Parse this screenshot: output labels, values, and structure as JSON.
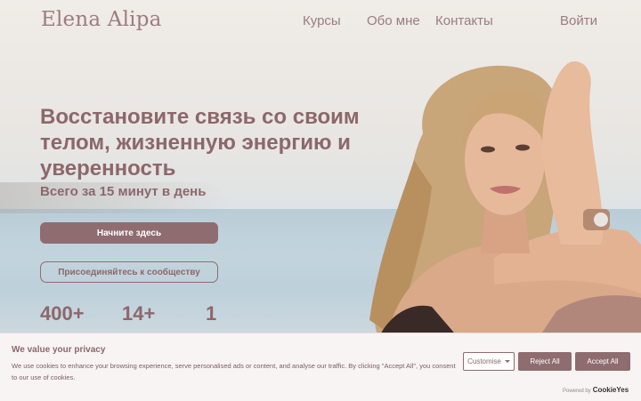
{
  "nav": {
    "logo": "Elena Alipa",
    "links": [
      "Курсы",
      "Обо мне",
      "Контакты"
    ],
    "login": "Войти"
  },
  "hero": {
    "headline": "Восстановите связь со своим телом, жизненную энергию и уверенность",
    "subheadline": "Всего за 15 минут в день",
    "primary_button": "Начните здесь",
    "secondary_button": "Присоединяйтесь к сообществу",
    "stats": [
      "400+",
      "14+",
      "1"
    ]
  },
  "cookie_banner": {
    "title": "We value your privacy",
    "text": "We use cookies to enhance your browsing experience, serve personalised ads or content, and analyse our traffic. By clicking \"Accept All\", you consent to our use of cookies.",
    "customise": "Customise",
    "reject": "Reject All",
    "accept": "Accept All",
    "powered_by": "Powered by",
    "brand": "CookieYes"
  },
  "colors": {
    "accent": "#8f6c70",
    "text": "#8c676b",
    "banner_bg": "#f8f4f4"
  }
}
